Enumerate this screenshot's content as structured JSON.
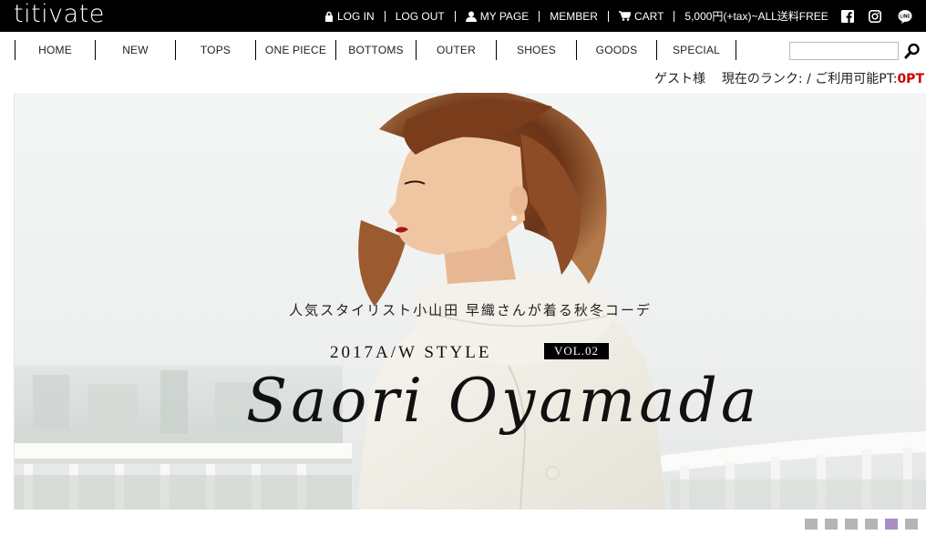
{
  "brand": {
    "logo": "titivate"
  },
  "toplinks": {
    "login": "LOG IN",
    "logout": "LOG OUT",
    "mypage": "MY PAGE",
    "member": "MEMBER",
    "cart": "CART",
    "shipping": "5,000円(+tax)~ALL送料FREE"
  },
  "social": [
    "facebook-icon",
    "instagram-icon",
    "line-icon"
  ],
  "nav": {
    "items": [
      {
        "label": "HOME"
      },
      {
        "label": "NEW"
      },
      {
        "label": "TOPS"
      },
      {
        "label": "ONE PIECE"
      },
      {
        "label": "BOTTOMS"
      },
      {
        "label": "OUTER"
      },
      {
        "label": "SHOES"
      },
      {
        "label": "GOODS"
      },
      {
        "label": "SPECIAL"
      }
    ]
  },
  "search": {
    "placeholder": "",
    "value": ""
  },
  "guest": {
    "name": "ゲスト様",
    "rank_label": "現在のランク: / ご利用可能PT:",
    "points": "0PT"
  },
  "hero": {
    "caption": "人気スタイリスト小山田 早織さんが着る秋冬コーデ",
    "style": "2017A/W STYLE",
    "vol": "VOL.02",
    "name": "Saori Oyamada"
  },
  "slider": {
    "count": 6,
    "active_index": 4
  },
  "colors": {
    "topbar": "#000000",
    "points": "#cc0000",
    "dot": "#b5b5b5",
    "dot_active": "#a98fc5"
  }
}
